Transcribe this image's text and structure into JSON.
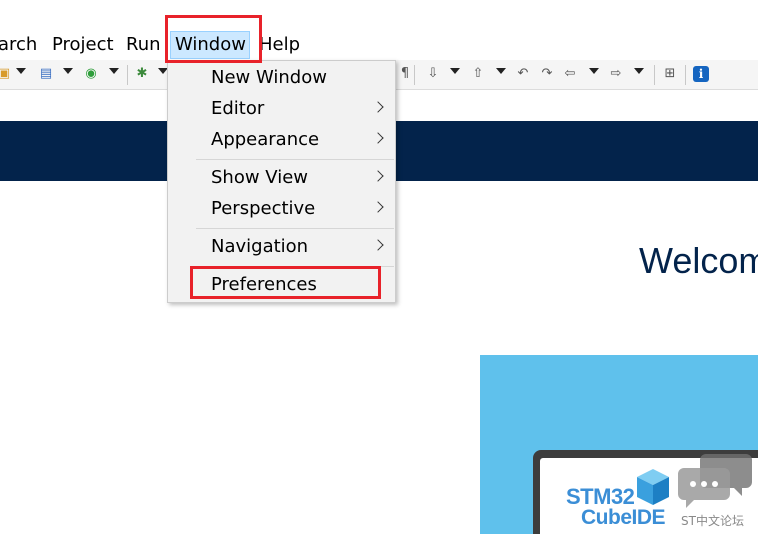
{
  "menubar": {
    "items": [
      "arch",
      "Project",
      "Run",
      "Window",
      "Help"
    ]
  },
  "dropdown": {
    "items": [
      {
        "label": "New Window",
        "submenu": false
      },
      {
        "label": "Editor",
        "submenu": true
      },
      {
        "label": "Appearance",
        "submenu": true
      },
      {
        "label": "Show View",
        "submenu": true
      },
      {
        "label": "Perspective",
        "submenu": true
      },
      {
        "label": "Navigation",
        "submenu": true
      },
      {
        "label": "Preferences",
        "submenu": false
      }
    ]
  },
  "welcome": {
    "title": "Welcom"
  },
  "promo": {
    "logo_line1": "STM32",
    "logo_line2": "CubeIDE"
  },
  "watermark": {
    "text": "ST中文论坛"
  },
  "toolbar": {
    "info_glyph": "i"
  },
  "colors": {
    "banner": "#03234b",
    "promo": "#5fc1ec",
    "highlight": "#e8222a",
    "menu_selected": "#cce8ff"
  }
}
